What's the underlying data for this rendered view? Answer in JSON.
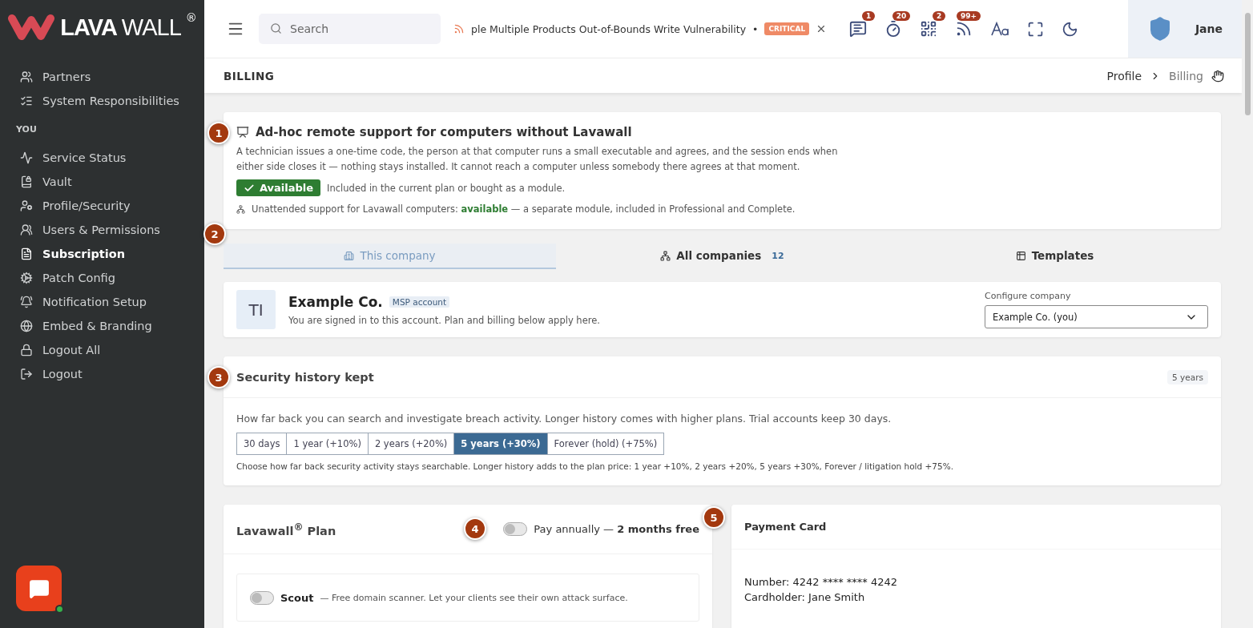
{
  "sidebar": {
    "logo": {
      "strong": "LAVA",
      "light": "WALL",
      "mark": "®"
    },
    "top_items": [
      {
        "label": "Partners",
        "selected": false
      },
      {
        "label": "System Responsibilities",
        "selected": false
      }
    ],
    "section": "YOU",
    "items": [
      {
        "label": "Service Status",
        "selected": false
      },
      {
        "label": "Vault",
        "selected": false
      },
      {
        "label": "Profile/Security",
        "selected": false
      },
      {
        "label": "Users & Permissions",
        "selected": false
      },
      {
        "label": "Subscription",
        "selected": true
      },
      {
        "label": "Patch Config",
        "selected": false
      },
      {
        "label": "Notification Setup",
        "selected": false
      },
      {
        "label": "Embed & Branding",
        "selected": false
      },
      {
        "label": "Logout All",
        "selected": false
      },
      {
        "label": "Logout",
        "selected": false
      }
    ],
    "chat": {
      "online": true
    }
  },
  "topbar": {
    "search": {
      "placeholder": "Search"
    },
    "ticker": {
      "text": "ple Multiple Products Out-of-Bounds Write Vulnerability",
      "separator": "•",
      "severity": "CRITICAL"
    },
    "badges": [
      "1",
      "20",
      "2",
      "99+"
    ],
    "user": "Jane"
  },
  "header": {
    "title": "BILLING",
    "breadcrumbs": [
      "Profile",
      "Billing"
    ]
  },
  "remote_card": {
    "marker": "1",
    "title": "Ad-hoc remote support for computers without Lavawall",
    "description": "A technician issues a one-time code, the person at that computer runs a small executable and agrees, and the session ends when either side closes it — nothing stays installed. It cannot reach a computer unless somebody there agrees at that moment.",
    "status": "Available",
    "status_note": "Included in the current plan or bought as a module.",
    "unattended": "Unattended support for Lavawall computers: **available** — a separate module, included in Professional and Complete."
  },
  "tabs_marker": "2",
  "tabs": [
    {
      "label": "This company",
      "selected": true
    },
    {
      "label": "All companies",
      "count": "12",
      "selected": false
    },
    {
      "label": "Templates",
      "selected": false
    }
  ],
  "company": {
    "initials": "TI",
    "name": "Example Co.",
    "tag": "MSP account",
    "note": "You are signed in to this account. Plan and billing below apply here.",
    "select_label": "Configure company",
    "select_value": "Example Co. (you)"
  },
  "history": {
    "marker": "3",
    "title": "Security history kept",
    "badge": "5 years",
    "description": "How far back you can search and investigate breach activity. Longer history comes with higher plans. Trial accounts keep 30 days.",
    "options": [
      {
        "label": "30 days",
        "selected": false
      },
      {
        "label": "1 year (+10%)",
        "selected": false
      },
      {
        "label": "2 years (+20%)",
        "selected": false
      },
      {
        "label": "5 years (+30%)",
        "selected": true
      },
      {
        "label": "Forever (hold) (+75%)",
        "selected": false
      }
    ],
    "footnote": "Choose how far back security activity stays searchable. Longer history adds to the plan price: 1 year +10%, 2 years +20%, 5 years +30%, Forever / litigation hold +75%."
  },
  "plan": {
    "marker": "4",
    "title": "Lavawall$^{®}$ Plan",
    "annual": {
      "on": false,
      "label": "Pay annually — **2 months free**"
    },
    "plans": [
      {
        "name": "Scout",
        "description": "— Free domain scanner. Let your clients see their own attack surface.",
        "on": false
      }
    ]
  },
  "payment": {
    "marker": "5",
    "title": "Payment Card",
    "lines": [
      "Number: 4242 **** **** 4242",
      "Cardholder: Jane Smith"
    ]
  }
}
